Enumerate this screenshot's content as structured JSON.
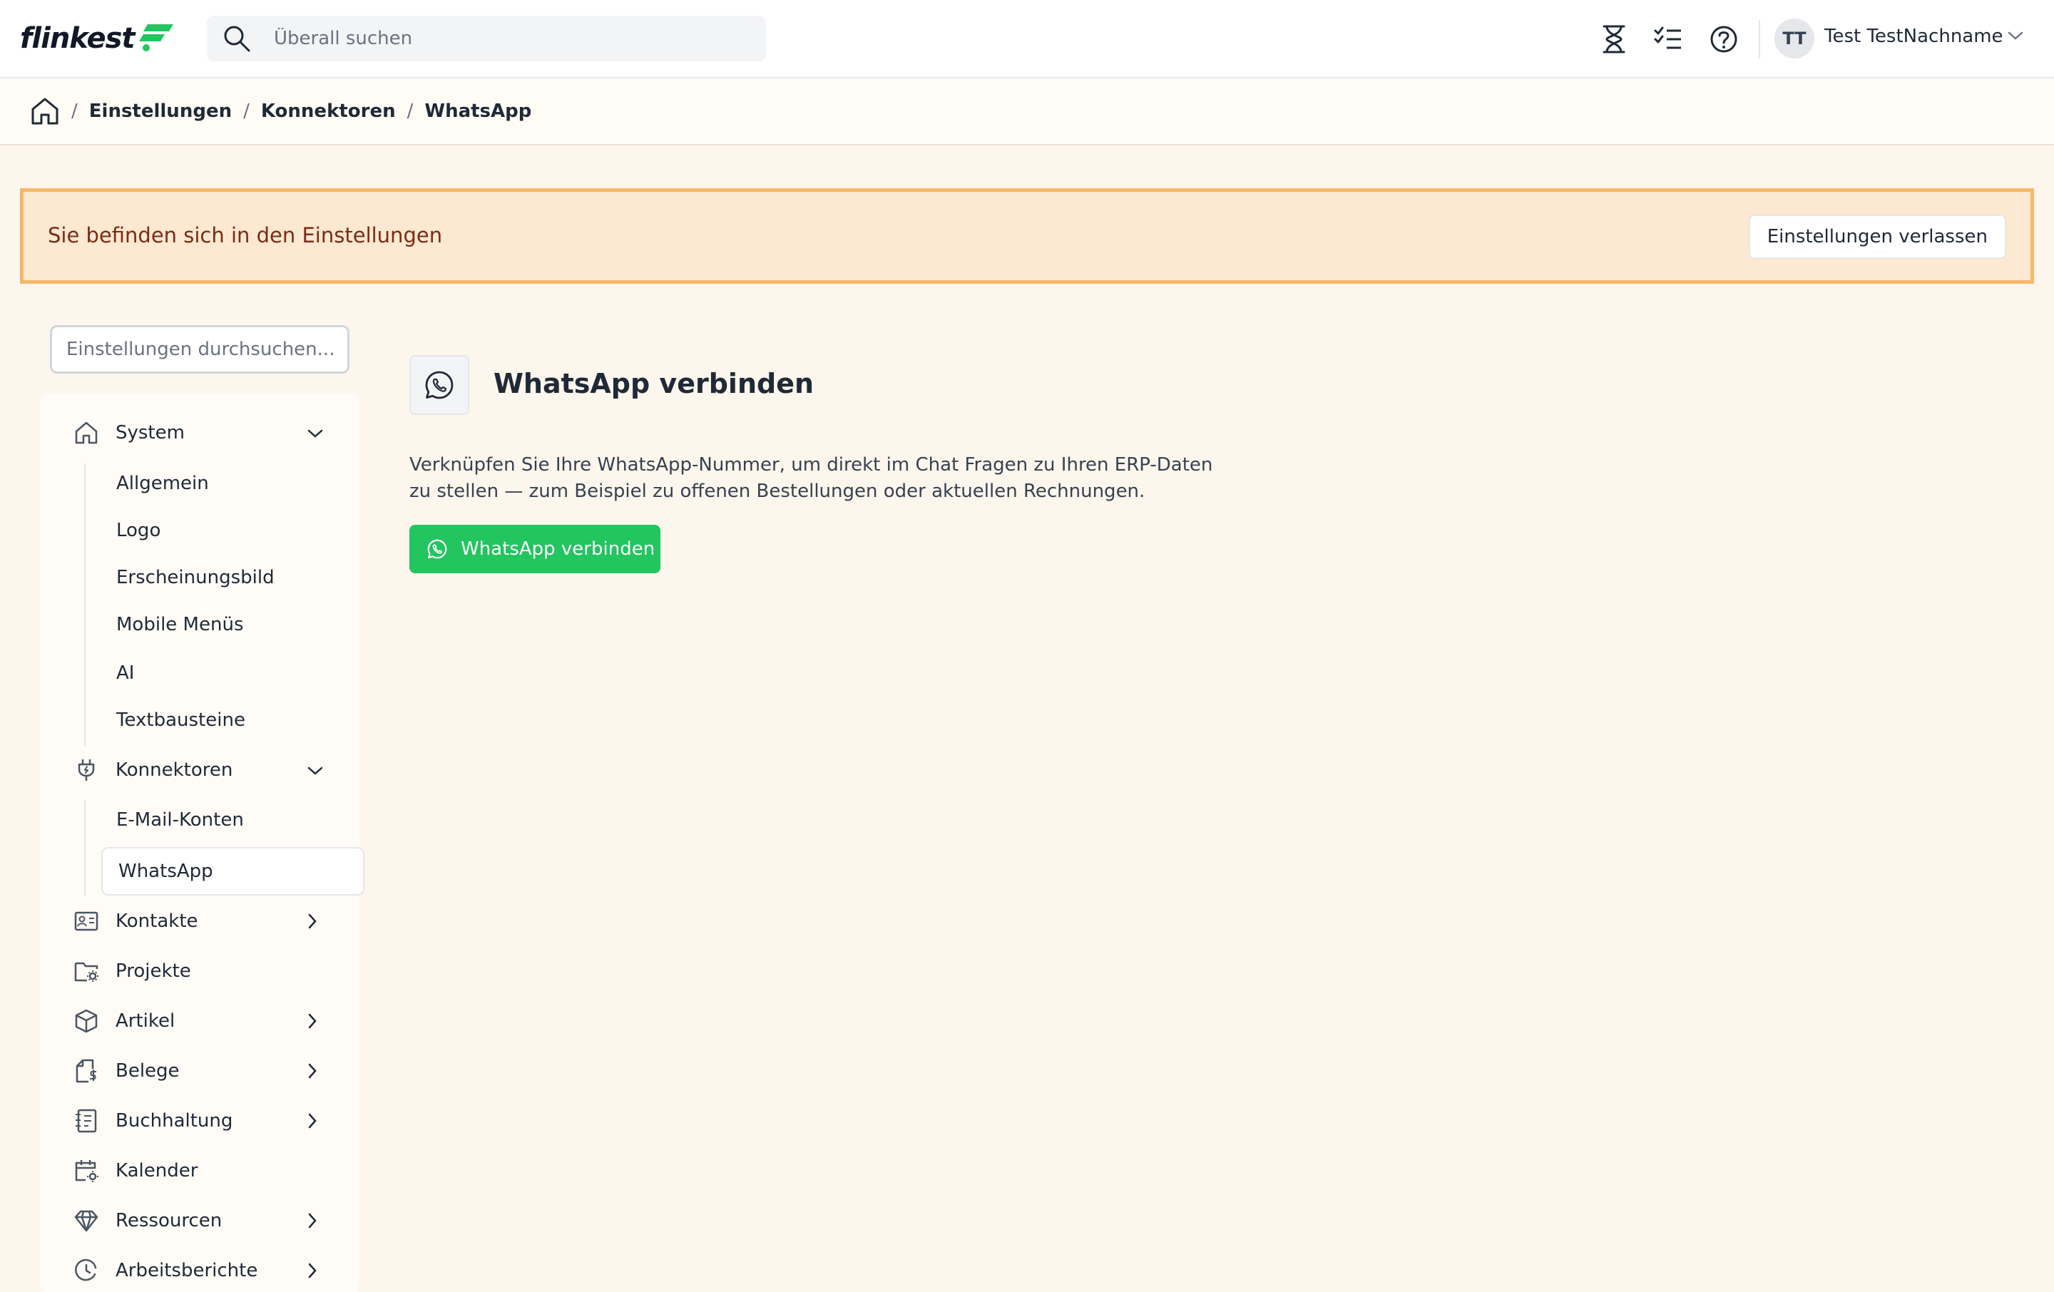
{
  "header": {
    "logo_text": "flinkest",
    "search_placeholder": "Überall suchen",
    "user": {
      "initials": "TT",
      "name": "Test TestNachname"
    },
    "colors": {
      "logo_accent": "#22c55e"
    }
  },
  "breadcrumb": [
    "Einstellungen",
    "Konnektoren",
    "WhatsApp"
  ],
  "banner": {
    "text": "Sie befinden sich in den Einstellungen",
    "button": "Einstellungen verlassen"
  },
  "sidebar": {
    "search_placeholder": "Einstellungen durchsuchen...",
    "system": {
      "label": "System",
      "icon": "home-icon",
      "items": [
        "Allgemein",
        "Logo",
        "Erscheinungsbild",
        "Mobile Menüs",
        "AI",
        "Textbausteine"
      ]
    },
    "connectors": {
      "label": "Konnektoren",
      "icon": "plug-icon",
      "items": [
        "E-Mail-Konten",
        "WhatsApp"
      ]
    },
    "groups": [
      {
        "label": "Kontakte",
        "icon": "contact-card-icon"
      },
      {
        "label": "Projekte",
        "icon": "folder-settings-icon"
      },
      {
        "label": "Artikel",
        "icon": "box-icon"
      },
      {
        "label": "Belege",
        "icon": "document-dollar-icon"
      },
      {
        "label": "Buchhaltung",
        "icon": "ledger-icon"
      },
      {
        "label": "Kalender",
        "icon": "calendar-settings-icon"
      },
      {
        "label": "Ressourcen",
        "icon": "diamond-icon"
      },
      {
        "label": "Arbeitsberichte",
        "icon": "clock-icon"
      }
    ]
  },
  "main": {
    "title": "WhatsApp verbinden",
    "description": "Verknüpfen Sie Ihre WhatsApp-Nummer, um direkt im Chat Fragen zu Ihren ERP-Daten zu stellen — zum Beispiel zu offenen Bestellungen oder aktuellen Rechnungen.",
    "button": "WhatsApp verbinden",
    "colors": {
      "button": "#22c55e"
    }
  }
}
